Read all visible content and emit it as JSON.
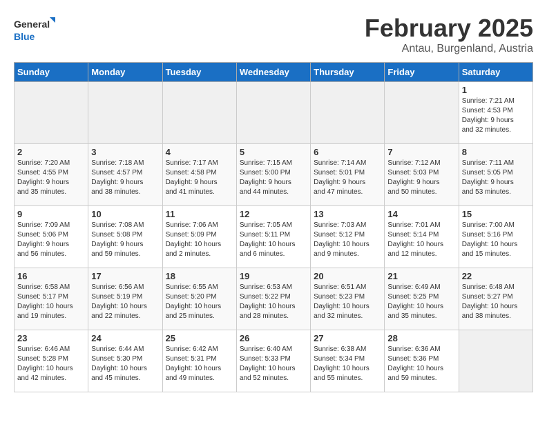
{
  "logo": {
    "line1": "General",
    "line2": "Blue"
  },
  "title": "February 2025",
  "subtitle": "Antau, Burgenland, Austria",
  "weekdays": [
    "Sunday",
    "Monday",
    "Tuesday",
    "Wednesday",
    "Thursday",
    "Friday",
    "Saturday"
  ],
  "weeks": [
    [
      {
        "day": "",
        "info": ""
      },
      {
        "day": "",
        "info": ""
      },
      {
        "day": "",
        "info": ""
      },
      {
        "day": "",
        "info": ""
      },
      {
        "day": "",
        "info": ""
      },
      {
        "day": "",
        "info": ""
      },
      {
        "day": "1",
        "info": "Sunrise: 7:21 AM\nSunset: 4:53 PM\nDaylight: 9 hours\nand 32 minutes."
      }
    ],
    [
      {
        "day": "2",
        "info": "Sunrise: 7:20 AM\nSunset: 4:55 PM\nDaylight: 9 hours\nand 35 minutes."
      },
      {
        "day": "3",
        "info": "Sunrise: 7:18 AM\nSunset: 4:57 PM\nDaylight: 9 hours\nand 38 minutes."
      },
      {
        "day": "4",
        "info": "Sunrise: 7:17 AM\nSunset: 4:58 PM\nDaylight: 9 hours\nand 41 minutes."
      },
      {
        "day": "5",
        "info": "Sunrise: 7:15 AM\nSunset: 5:00 PM\nDaylight: 9 hours\nand 44 minutes."
      },
      {
        "day": "6",
        "info": "Sunrise: 7:14 AM\nSunset: 5:01 PM\nDaylight: 9 hours\nand 47 minutes."
      },
      {
        "day": "7",
        "info": "Sunrise: 7:12 AM\nSunset: 5:03 PM\nDaylight: 9 hours\nand 50 minutes."
      },
      {
        "day": "8",
        "info": "Sunrise: 7:11 AM\nSunset: 5:05 PM\nDaylight: 9 hours\nand 53 minutes."
      }
    ],
    [
      {
        "day": "9",
        "info": "Sunrise: 7:09 AM\nSunset: 5:06 PM\nDaylight: 9 hours\nand 56 minutes."
      },
      {
        "day": "10",
        "info": "Sunrise: 7:08 AM\nSunset: 5:08 PM\nDaylight: 9 hours\nand 59 minutes."
      },
      {
        "day": "11",
        "info": "Sunrise: 7:06 AM\nSunset: 5:09 PM\nDaylight: 10 hours\nand 2 minutes."
      },
      {
        "day": "12",
        "info": "Sunrise: 7:05 AM\nSunset: 5:11 PM\nDaylight: 10 hours\nand 6 minutes."
      },
      {
        "day": "13",
        "info": "Sunrise: 7:03 AM\nSunset: 5:12 PM\nDaylight: 10 hours\nand 9 minutes."
      },
      {
        "day": "14",
        "info": "Sunrise: 7:01 AM\nSunset: 5:14 PM\nDaylight: 10 hours\nand 12 minutes."
      },
      {
        "day": "15",
        "info": "Sunrise: 7:00 AM\nSunset: 5:16 PM\nDaylight: 10 hours\nand 15 minutes."
      }
    ],
    [
      {
        "day": "16",
        "info": "Sunrise: 6:58 AM\nSunset: 5:17 PM\nDaylight: 10 hours\nand 19 minutes."
      },
      {
        "day": "17",
        "info": "Sunrise: 6:56 AM\nSunset: 5:19 PM\nDaylight: 10 hours\nand 22 minutes."
      },
      {
        "day": "18",
        "info": "Sunrise: 6:55 AM\nSunset: 5:20 PM\nDaylight: 10 hours\nand 25 minutes."
      },
      {
        "day": "19",
        "info": "Sunrise: 6:53 AM\nSunset: 5:22 PM\nDaylight: 10 hours\nand 28 minutes."
      },
      {
        "day": "20",
        "info": "Sunrise: 6:51 AM\nSunset: 5:23 PM\nDaylight: 10 hours\nand 32 minutes."
      },
      {
        "day": "21",
        "info": "Sunrise: 6:49 AM\nSunset: 5:25 PM\nDaylight: 10 hours\nand 35 minutes."
      },
      {
        "day": "22",
        "info": "Sunrise: 6:48 AM\nSunset: 5:27 PM\nDaylight: 10 hours\nand 38 minutes."
      }
    ],
    [
      {
        "day": "23",
        "info": "Sunrise: 6:46 AM\nSunset: 5:28 PM\nDaylight: 10 hours\nand 42 minutes."
      },
      {
        "day": "24",
        "info": "Sunrise: 6:44 AM\nSunset: 5:30 PM\nDaylight: 10 hours\nand 45 minutes."
      },
      {
        "day": "25",
        "info": "Sunrise: 6:42 AM\nSunset: 5:31 PM\nDaylight: 10 hours\nand 49 minutes."
      },
      {
        "day": "26",
        "info": "Sunrise: 6:40 AM\nSunset: 5:33 PM\nDaylight: 10 hours\nand 52 minutes."
      },
      {
        "day": "27",
        "info": "Sunrise: 6:38 AM\nSunset: 5:34 PM\nDaylight: 10 hours\nand 55 minutes."
      },
      {
        "day": "28",
        "info": "Sunrise: 6:36 AM\nSunset: 5:36 PM\nDaylight: 10 hours\nand 59 minutes."
      },
      {
        "day": "",
        "info": ""
      }
    ]
  ]
}
